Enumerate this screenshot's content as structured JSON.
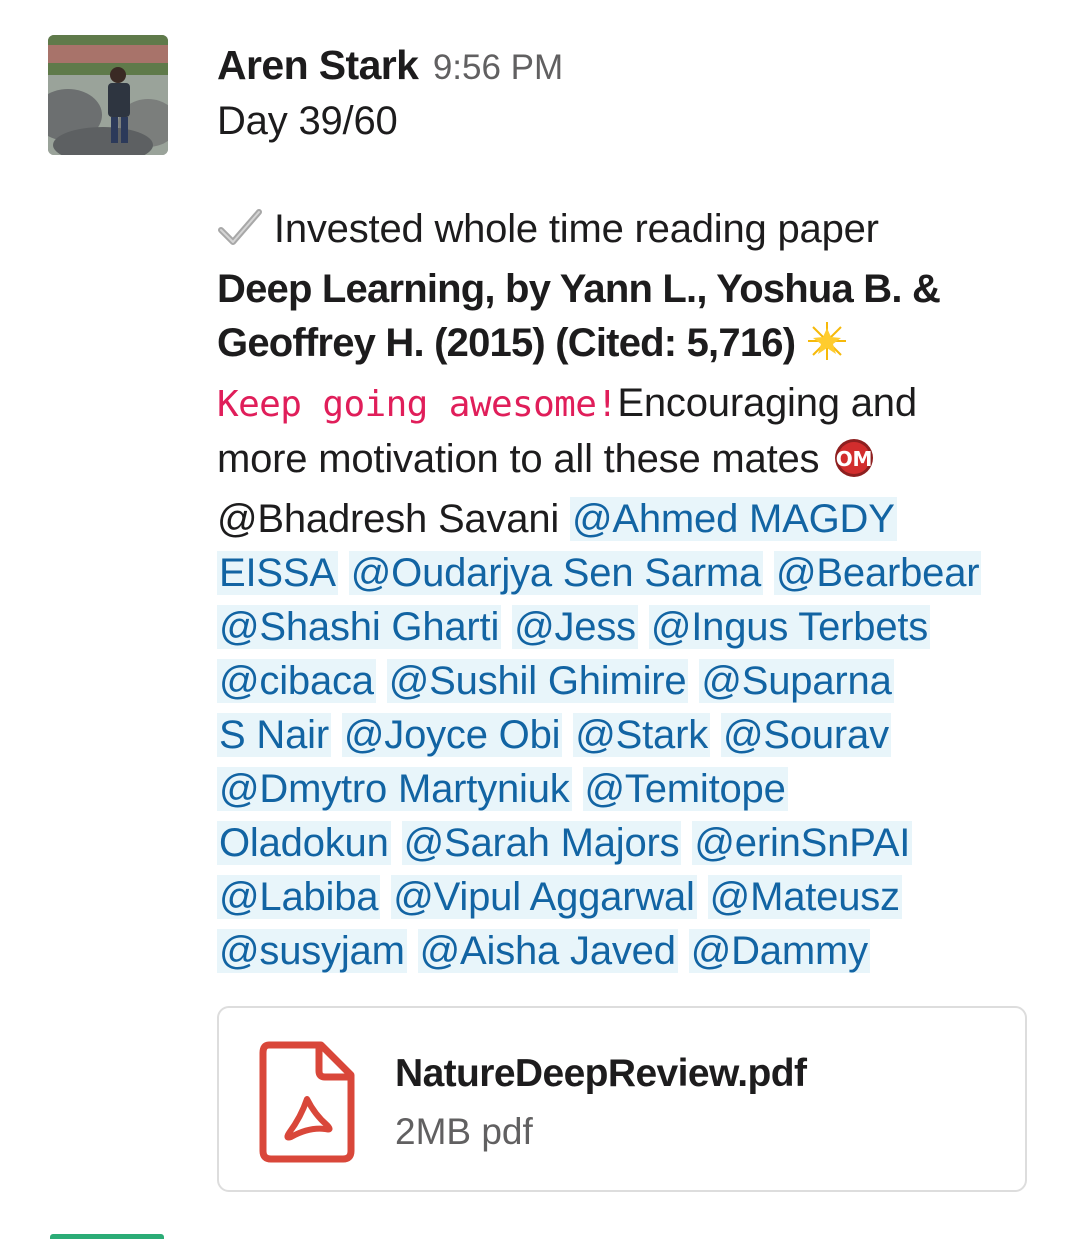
{
  "message": {
    "sender": "Aren Stark",
    "time": "9:56 PM",
    "day": "Day 39/60",
    "line_checkmark_text": "Invested whole time reading paper",
    "paper_line_1": "Deep Learning, by Yann L., Yoshua B. &",
    "paper_line_2": "Geoffrey H. (2015) (Cited: 5,716)",
    "code_text": "Keep going awesome!",
    "after_code_text": "Encouraging and",
    "motivation_text": "more motivation to all these mates",
    "mentions": {
      "bhadresh": "@Bhadresh Savani",
      "ahmed_1": "@Ahmed MAGDY",
      "ahmed_2": "EISSA",
      "oudarjya": "@Oudarjya Sen Sarma",
      "bearbear": "@Bearbear",
      "shashi": "@Shashi Gharti",
      "jess": "@Jess",
      "ingus": "@Ingus Terbets",
      "cibaca": "@cibaca",
      "sushil": "@Sushil Ghimire",
      "suparna_1": "@Suparna",
      "suparna_2": "S Nair",
      "joyce": "@Joyce Obi",
      "stark": "@Stark",
      "sourav": "@Sourav",
      "dmytro": "@Dmytro Martyniuk",
      "temitope_1": "@Temitope",
      "temitope_2": "Oladokun",
      "sarah": "@Sarah Majors",
      "erin": "@erinSnPAI",
      "labiba": "@Labiba",
      "vipul": "@Vipul Aggarwal",
      "mateusz": "@Mateusz",
      "susyjam": "@susyjam",
      "aisha": "@Aisha Javed",
      "dammy": "@Dammy"
    },
    "emoji_names": [
      "check-mark-emoji",
      "glowing-star-emoji",
      "om-emoji"
    ]
  },
  "attachment": {
    "file_name": "NatureDeepReview.pdf",
    "file_meta": "2MB pdf",
    "icon": "pdf-file-icon"
  },
  "colors": {
    "text": "#1d1c1d",
    "muted": "#616061",
    "mention": "#1264a3",
    "mention_bg": "#e8f5fa",
    "code": "#e01e5a",
    "pdf_red": "#d9473a"
  }
}
